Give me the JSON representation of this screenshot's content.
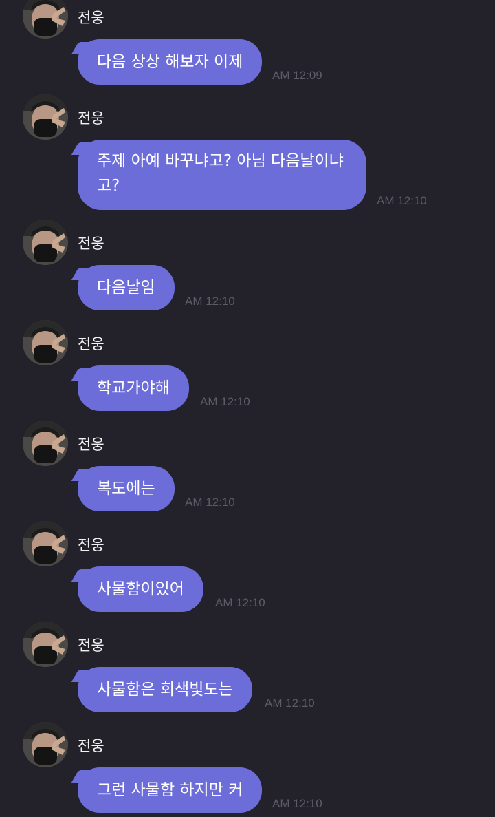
{
  "chat": {
    "messages": [
      {
        "sender": "전웅",
        "text": "다음 상상 해보자 이제",
        "time": "AM 12:09"
      },
      {
        "sender": "전웅",
        "text": "주제 아예 바꾸냐고? 아님 다음날이냐고?",
        "time": "AM 12:10"
      },
      {
        "sender": "전웅",
        "text": "다음날임",
        "time": "AM 12:10"
      },
      {
        "sender": "전웅",
        "text": "학교가야해",
        "time": "AM 12:10"
      },
      {
        "sender": "전웅",
        "text": "복도에는",
        "time": "AM 12:10"
      },
      {
        "sender": "전웅",
        "text": "사물함이있어",
        "time": "AM 12:10"
      },
      {
        "sender": "전웅",
        "text": "사물함은 회색빛도는",
        "time": "AM 12:10"
      },
      {
        "sender": "전웅",
        "text": "그런 사물함 하지만 커",
        "time": "AM 12:10"
      }
    ]
  },
  "colors": {
    "background": "#23222b",
    "bubble": "#6c6dd9",
    "timestamp": "#5d5c66"
  },
  "icons": {
    "avatar": "profile-photo-avatar"
  }
}
